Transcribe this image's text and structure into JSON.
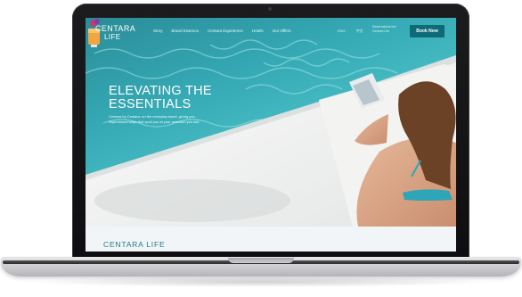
{
  "brand": {
    "logo_line1": "CENTARA",
    "logo_line2": "LIFE"
  },
  "nav": {
    "items": [
      "Story",
      "Brand Essence",
      "Centara Experience",
      "Hotels",
      "Our Offers"
    ],
    "utility": [
      "ENG",
      "中文"
    ],
    "contact": "Reservations line\nCentara Life",
    "book_label": "Book Now"
  },
  "hero": {
    "headline": "Elevating the Essentials",
    "body": "Centara by Centara: on the everyday travel, giving you inspirational ways that spoil you at your selection you ask."
  },
  "section": {
    "title": "CENTARA LIFE"
  },
  "colors": {
    "accent": "#0f6a78",
    "pool": "#3fb5be",
    "section_title": "#1f7a86"
  }
}
